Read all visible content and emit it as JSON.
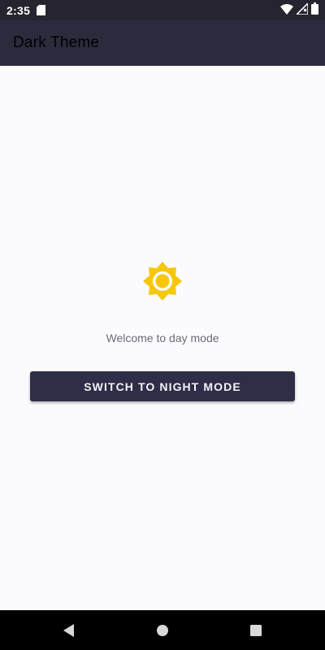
{
  "status_bar": {
    "time": "2:35",
    "icons": [
      "sd-card-icon",
      "wifi-icon",
      "signal-icon",
      "battery-icon"
    ]
  },
  "app_bar": {
    "title": "Dark Theme"
  },
  "main": {
    "icon": "sun-icon",
    "welcome_text": "Welcome to day mode",
    "switch_button_label": "SWITCH TO NIGHT MODE"
  },
  "nav_bar": {
    "buttons": [
      "back-icon",
      "home-icon",
      "recents-icon"
    ]
  },
  "colors": {
    "accent": "#f6c70a",
    "app_bar": "#2c2b3d",
    "button": "#2f2e48",
    "background": "#fbfbfe"
  }
}
